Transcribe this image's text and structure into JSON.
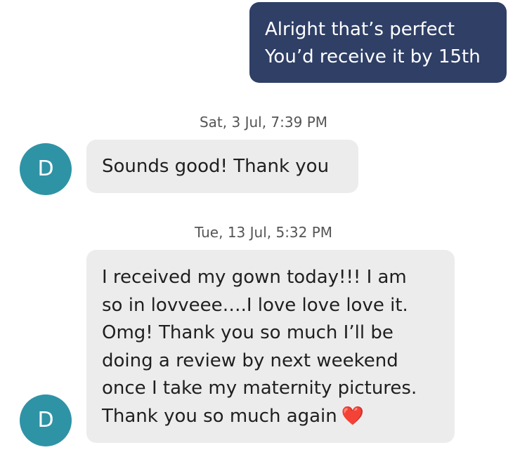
{
  "messages": [
    {
      "id": "m1",
      "direction": "outgoing",
      "text": "Alright that’s perfect\nYou’d receive it by 15th"
    },
    {
      "id": "t1",
      "type": "timestamp",
      "text": "Sat, 3 Jul, 7:39 PM"
    },
    {
      "id": "m2",
      "direction": "incoming",
      "avatar_initial": "D",
      "text": "Sounds good! Thank you"
    },
    {
      "id": "t2",
      "type": "timestamp",
      "text": "Tue, 13 Jul, 5:32 PM"
    },
    {
      "id": "m3",
      "direction": "incoming",
      "avatar_initial": "D",
      "text": "I received my gown today!!! I am\nso in lovveee….I love love love it.\nOmg!  Thank you so much I’ll be\ndoing a review by next weekend\nonce I take my maternity pictures.\nThank you so much again",
      "emoji": "❤️"
    }
  ],
  "colors": {
    "outgoing_bubble": "#2f3f66",
    "incoming_bubble": "#ececec",
    "avatar_bg": "#2f93a6",
    "timestamp_text": "#555555",
    "heart": "#e0202c"
  },
  "icons": {
    "heart": "red-heart-emoji"
  }
}
